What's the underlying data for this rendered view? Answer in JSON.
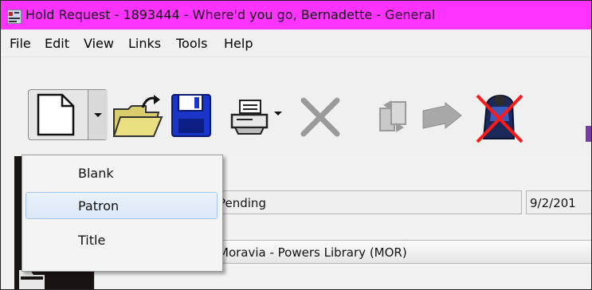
{
  "window": {
    "title": "Hold Request - 1893444 - Where'd you go, Bernadette - General",
    "titlebar_color": "#ff33ff"
  },
  "menu": {
    "file": "File",
    "edit": "Edit",
    "view": "View",
    "links": "Links",
    "tools": "Tools",
    "help": "Help"
  },
  "toolbar": {
    "icons": [
      "new-document-icon",
      "dropdown-arrow-icon",
      "open-folder-icon",
      "save-disk-icon",
      "print-icon",
      "print-dropdown-arrow-icon",
      "delete-x-icon",
      "transfer-icon",
      "arrow-icon",
      "patron-blocked-icon"
    ]
  },
  "new_menu": {
    "items": [
      {
        "label": "Blank"
      },
      {
        "label": "Patron"
      },
      {
        "label": "Title"
      }
    ]
  },
  "form": {
    "status": "Pending",
    "date": "9/2/201",
    "pickup_library": "Moravia - Powers Library (MOR)"
  }
}
